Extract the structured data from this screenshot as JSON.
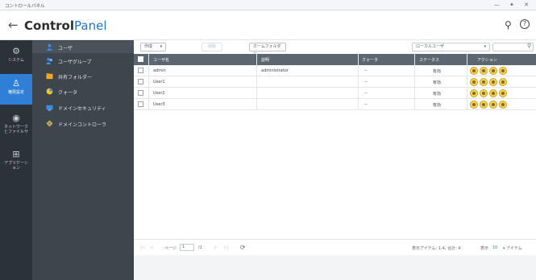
{
  "window": {
    "title": "コントロールパネル",
    "controls": "— ✦ ✕"
  },
  "header": {
    "back_glyph": "←",
    "title_prefix": "Control",
    "title_suffix": "Panel",
    "search_glyph": "⚲",
    "help_glyph": "?"
  },
  "rail": [
    {
      "label": "システム",
      "icon": "gear-icon",
      "glyph": "⚙"
    },
    {
      "label": "権限設定",
      "icon": "user-icon",
      "glyph": "♙",
      "active": true
    },
    {
      "label": "ネットワーク\nとファイルサ",
      "icon": "network-icon",
      "glyph": "◉"
    },
    {
      "label": "アプリケーシ\nョン",
      "icon": "apps-icon",
      "glyph": "⊞"
    }
  ],
  "subnav": [
    {
      "label": "ユーザ",
      "icon": "user-icon",
      "color": "#3a8ee6",
      "active": true
    },
    {
      "label": "ユーザグループ",
      "icon": "user-group-icon",
      "color": "#3a8ee6"
    },
    {
      "label": "共有フォルダー",
      "icon": "shared-folder-icon",
      "color": "#f5a623"
    },
    {
      "label": "クォータ",
      "icon": "quota-icon",
      "color": "#f5c518"
    },
    {
      "label": "ドメインセキュリティ",
      "icon": "domain-security-icon",
      "color": "#3a8ee6"
    },
    {
      "label": "ドメインコントローラ",
      "icon": "domain-controller-icon",
      "color": "#f5a623"
    }
  ],
  "toolbar": {
    "create_label": "作成",
    "create_caret": "▾",
    "delete_label": "削除",
    "home_folder_label": "ホームフォルダー",
    "filter_value": "ローカルユーザ",
    "filter_caret": "▾",
    "search_glyph": "⚲"
  },
  "table": {
    "headers": [
      "ユーザ名",
      "説明",
      "クォータ",
      "ステータス",
      "アクション"
    ],
    "rows": [
      {
        "name": "admin",
        "description": "administrator",
        "quota": "--",
        "status": "有効"
      },
      {
        "name": "User1",
        "description": "",
        "quota": "--",
        "status": "有効"
      },
      {
        "name": "User2",
        "description": "",
        "quota": "--",
        "status": "有効"
      },
      {
        "name": "User3",
        "description": "",
        "quota": "--",
        "status": "有効"
      }
    ]
  },
  "footer": {
    "first": "|◁",
    "prev": "◁",
    "page_label": "ページ",
    "page_value": "1",
    "of_label": "/1",
    "next": "▷",
    "last": "▷|",
    "refresh": "⟳",
    "summary": "表示アイテム: 1-4, 合計: 4",
    "per_page_label": "表示",
    "per_page_value": "10",
    "per_page_suffix": "▾ アイテム"
  }
}
